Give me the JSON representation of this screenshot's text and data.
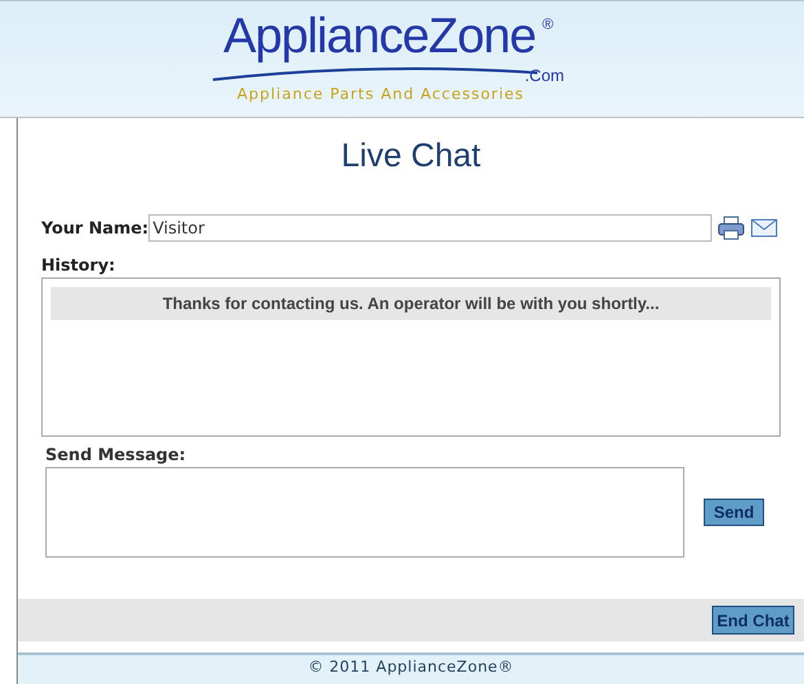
{
  "logo": {
    "name": "ApplianceZone",
    "mark": "®",
    "domain": ".Com",
    "tagline": "Appliance Parts And Accessories"
  },
  "title": "Live Chat",
  "name_field": {
    "label": "Your Name:",
    "value": "Visitor"
  },
  "history": {
    "label": "History:",
    "messages": [
      "Thanks for contacting us. An operator will be with you shortly..."
    ]
  },
  "message": {
    "label": "Send Message:"
  },
  "send_button": "Send",
  "end_button": "End Chat",
  "footer": "© 2011 ApplianceZone®"
}
